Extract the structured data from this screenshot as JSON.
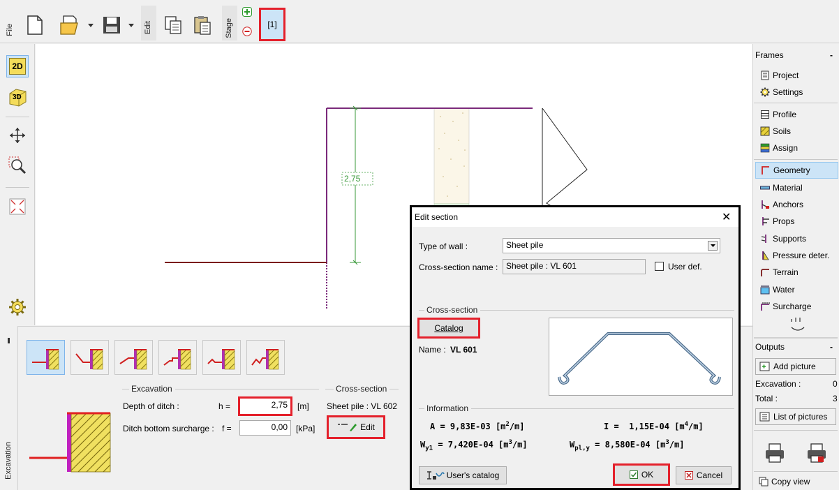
{
  "toolbar": {
    "file_label": "File",
    "edit_label": "Edit",
    "stage_label": "Stage",
    "stage_tab_label": "[1]"
  },
  "canvas": {
    "dimension_label": "2,75"
  },
  "left_toolbar": {
    "view_2d_label": "2D",
    "view_3d_label": "3D"
  },
  "frames": {
    "title": "Frames",
    "collapse_label": "-",
    "items": [
      {
        "label": "Project",
        "icon": "document-icon"
      },
      {
        "label": "Settings",
        "icon": "gear-icon"
      },
      {
        "label": "Profile",
        "icon": "profile-icon"
      },
      {
        "label": "Soils",
        "icon": "soil-icon"
      },
      {
        "label": "Assign",
        "icon": "assign-icon"
      },
      {
        "label": "Geometry",
        "icon": "geometry-icon"
      },
      {
        "label": "Material",
        "icon": "material-icon"
      },
      {
        "label": "Anchors",
        "icon": "anchor-icon"
      },
      {
        "label": "Props",
        "icon": "props-icon"
      },
      {
        "label": "Supports",
        "icon": "supports-icon"
      },
      {
        "label": "Pressure deter.",
        "icon": "pressure-icon"
      },
      {
        "label": "Terrain",
        "icon": "terrain-icon"
      },
      {
        "label": "Water",
        "icon": "water-icon"
      },
      {
        "label": "Surcharge",
        "icon": "surcharge-icon"
      }
    ],
    "active_item": "Geometry"
  },
  "outputs": {
    "title": "Outputs",
    "collapse_label": "-",
    "add_picture_label": "Add picture",
    "excavation_label": "Excavation :",
    "excavation_count": "0",
    "total_label": "Total :",
    "total_count": "3",
    "list_of_pictures_label": "List of pictures",
    "copy_view_label": "Copy view"
  },
  "bottom_panel": {
    "side_label": "Excavation",
    "excavation_group_title": "Excavation",
    "depth_label": "Depth of ditch :",
    "depth_symbol": "h =",
    "depth_value": "2,75",
    "depth_unit": "[m]",
    "surcharge_label": "Ditch bottom surcharge :",
    "surcharge_symbol": "f =",
    "surcharge_value": "0,00",
    "surcharge_unit": "[kPa]",
    "cross_section_group_title": "Cross-section",
    "cross_section_value": "Sheet pile : VL 602",
    "edit_button_label": "Edit"
  },
  "dialog": {
    "title": "Edit section",
    "close_label": "✕",
    "type_of_wall_label": "Type of wall :",
    "type_of_wall_value": "Sheet pile",
    "cross_section_name_label": "Cross-section name :",
    "cross_section_name_value": "Sheet pile : VL 601",
    "user_def_label": "User def.",
    "cross_section_group_title": "Cross-section",
    "catalog_button_label": "Catalog",
    "name_label": "Name :",
    "name_value": "VL 601",
    "information_group_title": "Information",
    "info": {
      "A_label": "A =",
      "A_value": "9,83E-03",
      "A_unit_pre": "[m",
      "A_unit_sup": "2",
      "A_unit_post": "/m]",
      "I_label": "I =",
      "I_value": "1,15E-04",
      "I_unit_pre": "[m",
      "I_unit_sup": "4",
      "I_unit_post": "/m]",
      "Wy1_label": "W",
      "Wy1_sub": "y1",
      "Wy1_eq": "=",
      "Wy1_value": "7,420E-04",
      "Wy1_unit_pre": "[m",
      "Wy1_unit_sup": "3",
      "Wy1_unit_post": "/m]",
      "Wply_label": "W",
      "Wply_sub": "pl,y",
      "Wply_eq": "=",
      "Wply_value": "8,580E-04",
      "Wply_unit_pre": "[m",
      "Wply_unit_sup": "3",
      "Wply_unit_post": "/m]"
    },
    "users_catalog_label": "User's catalog",
    "ok_label": "OK",
    "cancel_label": "Cancel"
  },
  "colors": {
    "highlight_red": "#e4202b",
    "wall_purple": "#7b2a7b",
    "dimension_green": "#3a9a3a",
    "selected_blue": "#cce4f7"
  }
}
